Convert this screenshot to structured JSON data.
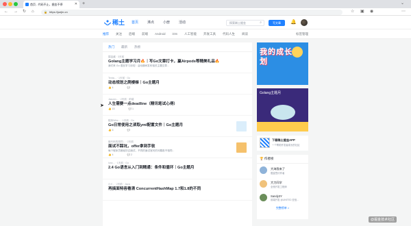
{
  "browser": {
    "tab_title": "首页 - 代码不止，掘金不停",
    "url": "https://juejin.cn",
    "colors": {
      "close": "#ff5f57",
      "minimize": "#febc2e",
      "maximize": "#28c840"
    }
  },
  "header": {
    "logo_text": "稀土",
    "nav": [
      "首页",
      "沸点",
      "小册",
      "活动"
    ],
    "search_placeholder": "探索稀土掘金",
    "create_label": "写文章",
    "brand_color": "#1e80ff"
  },
  "categories": {
    "items": [
      "推荐",
      "关注",
      "后端",
      "前端",
      "Android",
      "iOS",
      "人工智能",
      "开发工具",
      "代码人生",
      "阅读"
    ],
    "tag_manage": "标签管理"
  },
  "sorts": [
    "热门",
    "最新",
    "热榜"
  ],
  "entries": [
    {
      "meta": "掘金酱  ·  3天前",
      "title": "Golang主题学习月🔥｜写Go文章打卡，赢Airpods等精美礼品🔥",
      "abstract": "我们来 Go 语言学习月啦！活动期间发布相关主题文章...",
      "views": "",
      "likes": "",
      "comments": "",
      "thumb": false
    },
    {
      "meta": "Tenta...  ·  1天前  ·  Go",
      "title": "动态规划之爬楼梯｜Go主题月",
      "abstract": "",
      "views": "",
      "likes": "4",
      "comments": "",
      "thumb": false
    },
    {
      "meta": "Jasonn...  ·  2天前  ·  前端",
      "title": "人生需要一点deadline（精讯笔试心得）",
      "abstract": "",
      "views": "",
      "likes": "15",
      "comments": "1",
      "thumb": false
    },
    {
      "meta": "程序Wire...  ·  1天前  ·  Go",
      "title": "Go日常使用之读取yml配置文件｜Go主题月",
      "abstract": "",
      "views": "",
      "likes": "6",
      "comments": "",
      "thumb": true
    },
    {
      "meta": "敲代码的胡同...  ·  2天前",
      "title": "面试不踩坑，offer拿到手软",
      "abstract": "每个程序员都经历过面试，不同的面试官问的问题各不相同...",
      "views": "",
      "likes": "4",
      "comments": "2",
      "thumb": true
    },
    {
      "meta": "lunc...  ·  1天前  ·  Go",
      "title": "2.4 Go语言从入门到精通：条件和循环｜Go主题月",
      "abstract": "",
      "views": "",
      "likes": "",
      "comments": "",
      "thumb": false
    },
    {
      "meta": "小Y...  ·  2天前  ·  Java",
      "title": "再搞面特容看清 ConcurrentHashMap 1.7和1.8的不同",
      "abstract": "",
      "views": "",
      "likes": "",
      "comments": "",
      "thumb": false
    }
  ],
  "sidebar": {
    "banner1_text": "我的成长计划",
    "banner2_title": "Golang主题月",
    "app_title": "下载稀土掘金APP",
    "app_sub": "一个帮助开发者成长的社区",
    "authors_head": "🏆 作者榜",
    "authors": [
      {
        "name": "大海我来了",
        "desc": "掘金签约作者",
        "color": "#8fb3d9"
      },
      {
        "name": "大力同学",
        "desc": "全栈开发工程师",
        "color": "#f0c27b"
      },
      {
        "name": "Sandy3Y",
        "desc": "前端开发 @UNITED 亚信...",
        "color": "#6b8e5a"
      }
    ],
    "rank_link": "完整榜单 >"
  },
  "watermark": "@掘金技术社区"
}
